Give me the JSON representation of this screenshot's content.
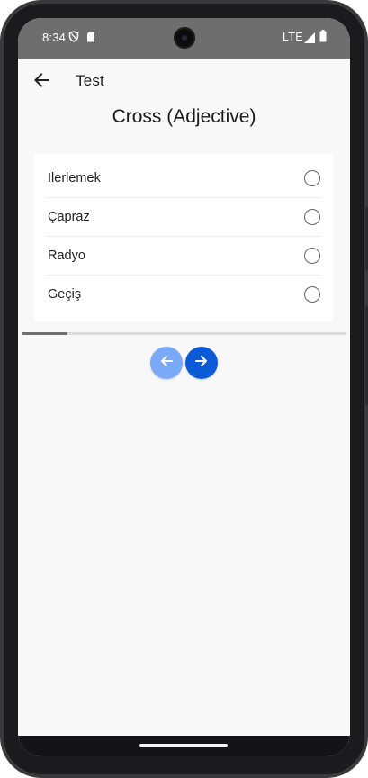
{
  "status_bar": {
    "time": "8:34",
    "network": "LTE",
    "icons": [
      "shield-icon",
      "sim-card-icon",
      "signal-icon",
      "battery-icon"
    ]
  },
  "app_bar": {
    "title": "Test",
    "back_icon": "arrow-left-icon"
  },
  "question": {
    "text": "Cross (Adjective)"
  },
  "options": [
    {
      "label": "Ilerlemek",
      "selected": false
    },
    {
      "label": "Çapraz",
      "selected": false
    },
    {
      "label": "Radyo",
      "selected": false
    },
    {
      "label": "Geçiş",
      "selected": false
    }
  ],
  "progress": {
    "fraction": 0.14
  },
  "navigation": {
    "prev_icon": "arrow-left-icon",
    "next_icon": "arrow-right-icon"
  },
  "colors": {
    "status_bar": "#6e6e6e",
    "screen_background": "#f8f8f8",
    "card_background": "#ffffff",
    "prev_button": "#7aa9f7",
    "next_button": "#0b5bd9",
    "progress_fill": "#707070",
    "progress_track": "#dcdcdc"
  }
}
